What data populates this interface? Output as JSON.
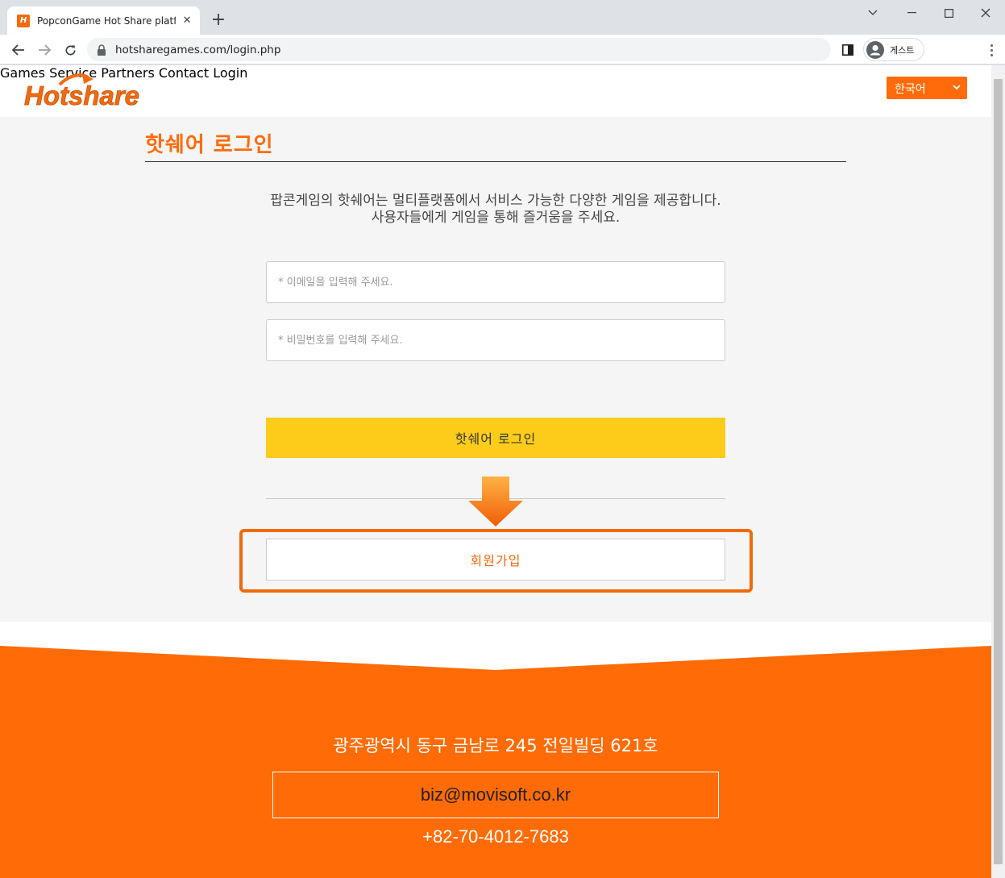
{
  "browser": {
    "tab_title": "PopconGame Hot Share platform",
    "favicon_text": "H",
    "url": "hotsharegames.com/login.php",
    "profile_label": "게스트"
  },
  "header": {
    "logo_text": "Hotshare",
    "nav": [
      "Games",
      "Service",
      "Partners",
      "Contact",
      "Login"
    ],
    "language": "한국어"
  },
  "login": {
    "title": "핫쉐어 로그인",
    "intro_line1": "팝콘게임의 핫쉐어는 멀티플랫폼에서 서비스 가능한 다양한 게임을 제공합니다.",
    "intro_line2": "사용자들에게 게임을 통해 즐거움을 주세요.",
    "email_placeholder": "* 이메일을 입력해 주세요.",
    "password_placeholder": "* 비밀번호를 입력해 주세요.",
    "login_button": "핫쉐어 로그인",
    "signup_button": "회원가입"
  },
  "footer": {
    "address": "광주광역시 동구 금남로 245 전일빌딩 621호",
    "email": "biz@movisoft.co.kr",
    "phone": "+82-70-4012-7683"
  },
  "colors": {
    "brand_orange": "#ff6b0a",
    "login_yellow": "#fdcc1a",
    "highlight": "#f06a0a"
  }
}
